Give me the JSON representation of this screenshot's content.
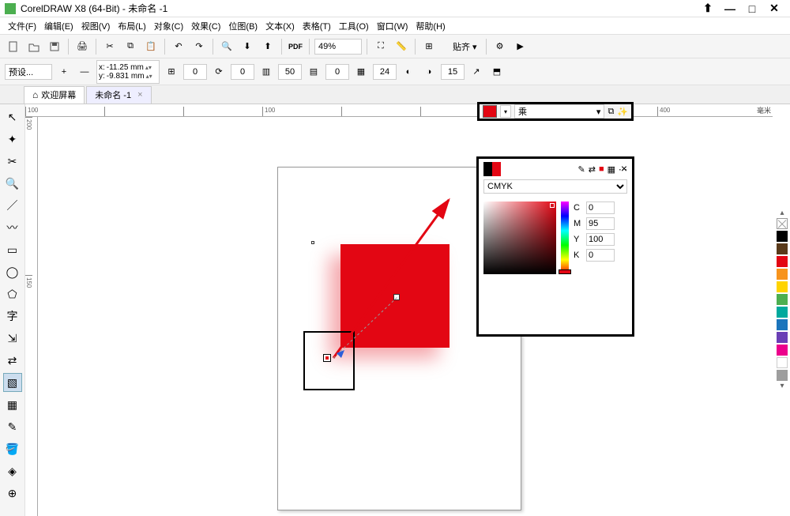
{
  "window": {
    "title": "CorelDRAW X8 (64-Bit) - 未命名 -1"
  },
  "menu": [
    "文件(F)",
    "编辑(E)",
    "视图(V)",
    "布局(L)",
    "对象(C)",
    "效果(C)",
    "位图(B)",
    "文本(X)",
    "表格(T)",
    "工具(O)",
    "窗口(W)",
    "帮助(H)"
  ],
  "toolbar1": {
    "zoom": "49%"
  },
  "toolbar2": {
    "preset": "预设...",
    "x": "-11.25 mm",
    "y": "-9.831 mm",
    "angle": "0",
    "copies_a": "0",
    "copies_b": "50",
    "copies_c": "0",
    "trans_a": "24",
    "trans_b": "15",
    "blendmode": "乘"
  },
  "tabs": {
    "welcome": "欢迎屏幕",
    "doc": "未命名 -1"
  },
  "ruler_h": [
    "100",
    "",
    "",
    "100",
    "",
    "",
    "",
    "",
    "400"
  ],
  "ruler_h_end": "毫米",
  "ruler_v": [
    "200",
    "",
    "150"
  ],
  "color_panel": {
    "mode": "乘",
    "model": "CMYK",
    "C": "0",
    "M": "95",
    "Y": "100",
    "K": "0",
    "swatch": "#e30613"
  },
  "palette": [
    "#000000",
    "#5a3a1a",
    "#e30613",
    "#f7941d",
    "#ffd400",
    "#4caf50",
    "#00a99d",
    "#1b75bc",
    "#6a3fb5",
    "#ec008c",
    "#ffffff",
    "#9e9e9e",
    "#c0c0c0",
    "#ffe0e0",
    "#e0ffe0"
  ]
}
